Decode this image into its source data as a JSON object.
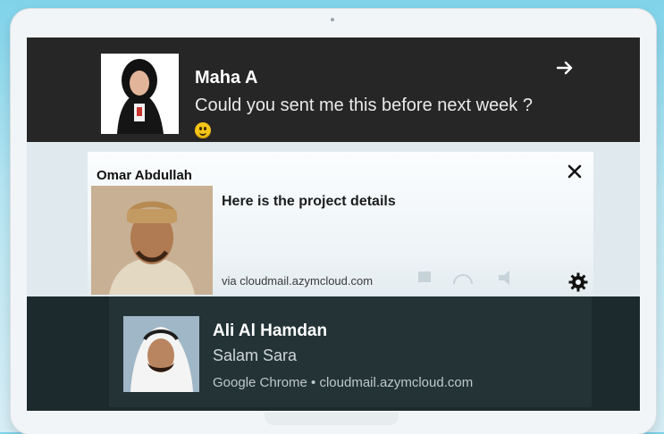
{
  "notifications": [
    {
      "sender": "Maha A",
      "message": "Could you sent me this before next week ?"
    },
    {
      "sender": "Omar Abdullah",
      "message": "Here is the project details",
      "source": "via cloudmail.azymcloud.com"
    },
    {
      "sender": "Ali Al Hamdan",
      "message": "Salam Sara",
      "source": "Google Chrome • cloudmail.azymcloud.com"
    }
  ],
  "icons": {
    "open": "arrow-right-icon",
    "close": "close-icon",
    "settings": "gear-icon",
    "emoji": "smiley-emoji"
  },
  "colors": {
    "dark_toast": "#262626",
    "light_toast": "#eef4f7",
    "teal_toast": "#233336"
  }
}
